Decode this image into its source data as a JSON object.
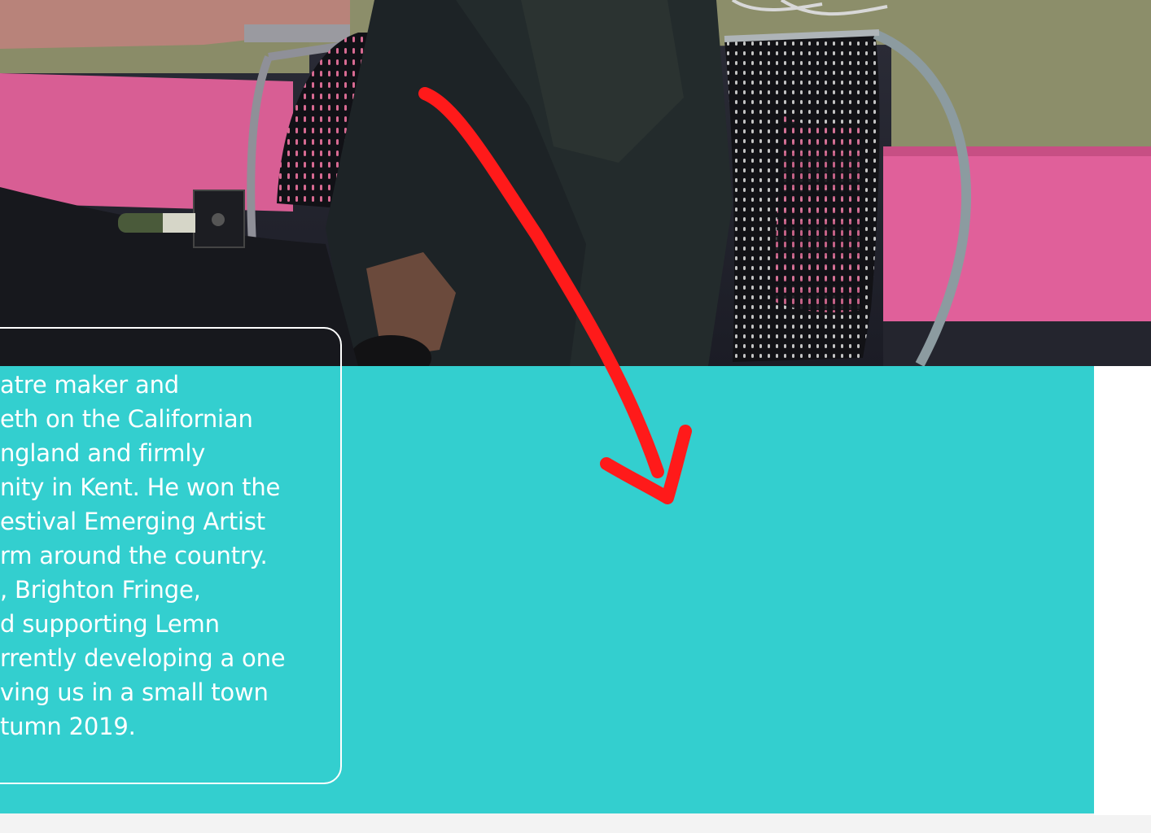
{
  "photo": {
    "icon": "performer-seated-on-chair-photo"
  },
  "bio": {
    "lines": [
      "atre maker and",
      "eth on the Californian",
      "ngland and firmly",
      "nity in Kent. He won the",
      "estival Emerging Artist",
      "rm around the country.",
      ", Brighton Fringe,",
      "d supporting Lemn",
      "rrently developing a one",
      "ving us in a small town",
      "tumn 2019."
    ]
  },
  "annotation": {
    "icon": "red-arrow-annotation-icon",
    "color": "#ff1a1a"
  },
  "colors": {
    "teal": "#33cfcf",
    "pink": "#e0609a",
    "white": "#ffffff"
  }
}
